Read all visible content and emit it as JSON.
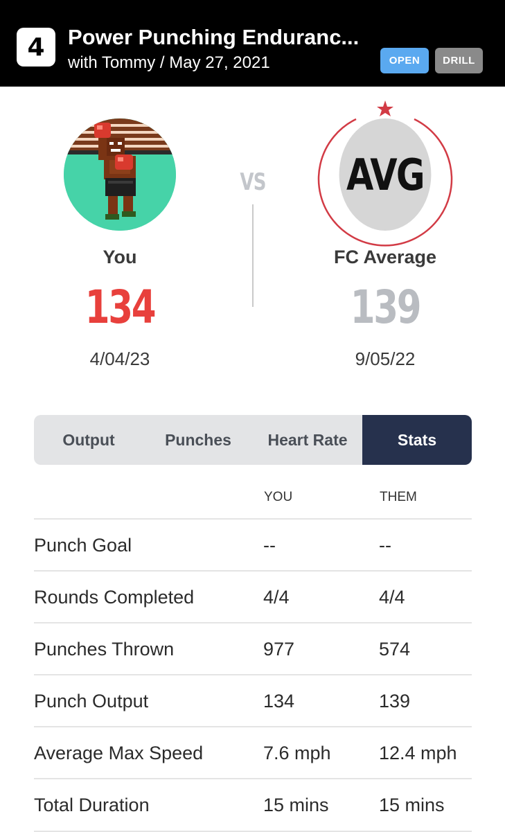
{
  "header": {
    "class_number": "4",
    "title": "Power Punching Enduranc...",
    "subtitle": "with Tommy / May 27, 2021",
    "badges": {
      "open": "OPEN",
      "drill": "DRILL"
    },
    "colors": {
      "background": "#000000",
      "open_badge": "#5aa9f0",
      "drill_badge": "#8a8a8a"
    }
  },
  "comparison": {
    "vs_label": "VS",
    "you": {
      "name": "You",
      "score": "134",
      "date": "4/04/23",
      "avatar": "boxer-avatar",
      "score_color": "#e8403c"
    },
    "them": {
      "name": "FC Average",
      "score": "139",
      "date": "9/05/22",
      "avatar_text": "AVG",
      "score_color": "#b9bcc1",
      "ring_color": "#d23b45"
    }
  },
  "tabs": {
    "items": [
      {
        "label": "Output",
        "active": false
      },
      {
        "label": "Punches",
        "active": false
      },
      {
        "label": "Heart Rate",
        "active": false
      },
      {
        "label": "Stats",
        "active": true
      }
    ],
    "active_color": "#26314d"
  },
  "stats": {
    "headers": {
      "you": "YOU",
      "them": "THEM"
    },
    "rows": [
      {
        "label": "Punch Goal",
        "you": "--",
        "them": "--"
      },
      {
        "label": "Rounds Completed",
        "you": "4/4",
        "them": "4/4"
      },
      {
        "label": "Punches Thrown",
        "you": "977",
        "them": "574"
      },
      {
        "label": "Punch Output",
        "you": "134",
        "them": "139"
      },
      {
        "label": "Average Max Speed",
        "you": "7.6 mph",
        "them": "12.4 mph"
      },
      {
        "label": "Total Duration",
        "you": "15 mins",
        "them": "15 mins"
      }
    ]
  }
}
